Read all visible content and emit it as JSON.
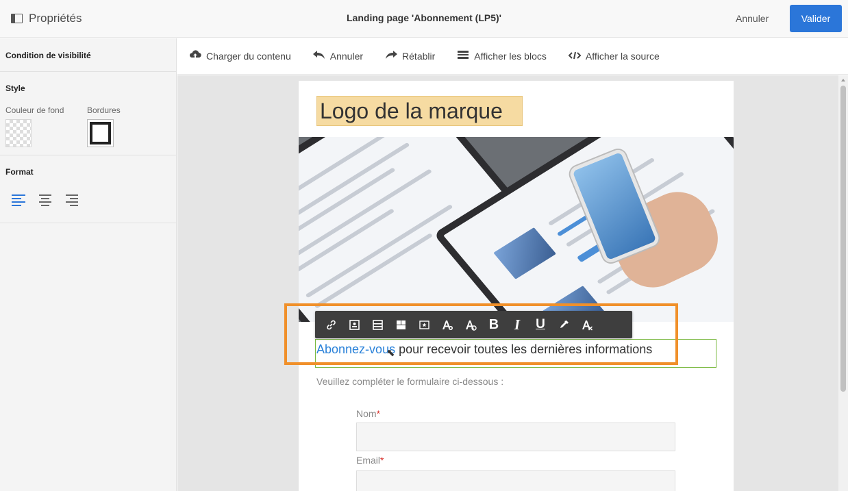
{
  "header": {
    "properties_label": "Propriétés",
    "title": "Landing page 'Abonnement (LP5)'",
    "cancel_label": "Annuler",
    "validate_label": "Valider"
  },
  "left_panel": {
    "visibility_condition": "Condition de visibilité",
    "style_heading": "Style",
    "background_color_label": "Couleur de fond",
    "borders_label": "Bordures",
    "format_heading": "Format",
    "alignment_selected": "left"
  },
  "toolbar": {
    "load_content": "Charger du contenu",
    "undo": "Annuler",
    "redo": "Rétablir",
    "show_blocks": "Afficher les blocs",
    "show_source": "Afficher la source"
  },
  "content": {
    "logo_text": "Logo de la marque",
    "intro_link": "Abonnez-vous",
    "intro_rest": " pour recevoir toutes les dernières informations",
    "subtitle": "Veuillez compléter le formulaire ci-dessous :",
    "field_name_label": "Nom",
    "field_email_label": "Email",
    "required_marker": "*"
  },
  "text_toolbar": {
    "buttons": [
      "link-icon",
      "personalization-icon",
      "insert-block-icon",
      "fragment-icon",
      "dynamic-content-icon",
      "font-color-icon",
      "font-background-icon",
      "bold-icon",
      "italic-icon",
      "underline-icon",
      "eyedropper-icon",
      "clear-format-icon"
    ],
    "bold_glyph": "B",
    "italic_glyph": "I",
    "underline_glyph": "U"
  },
  "colors": {
    "accent": "#2b76d9",
    "highlight": "#f0902a",
    "selection_outline": "#7ab940",
    "logo_background": "#f6dba2",
    "required": "#d8312b"
  }
}
